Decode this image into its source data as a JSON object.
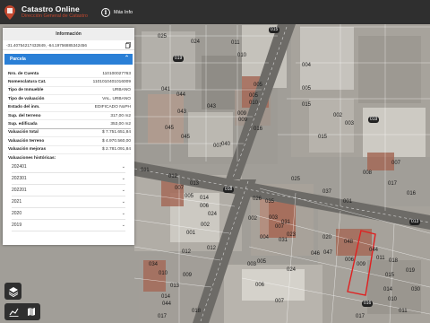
{
  "header": {
    "title": "Catastro Online",
    "subtitle": "Dirección General de Catastro",
    "more_info_label": "Más Info"
  },
  "panel": {
    "title": "Información",
    "coordinates": "-31.40754217432849, -64.19756885342456",
    "section_title": "Parcela",
    "rows": [
      {
        "key": "Nro. de Cuenta",
        "value": "110100027763"
      },
      {
        "key": "Nomenclatura Cat.",
        "value": "110101040101600​9"
      },
      {
        "key": "Tipo de Inmueble",
        "value": "URBANO"
      },
      {
        "key": "Tipo de valuación",
        "value": "VAL. URBANO"
      },
      {
        "key": "Estado del inm.",
        "value": "EDIFICADO NoPH"
      },
      {
        "key": "Sup. del terreno",
        "value": "317,00 m2"
      },
      {
        "key": "Sup. edificada",
        "value": "353,00 m2"
      },
      {
        "key": "Valuación total",
        "value": "$ 7.751.651,84"
      },
      {
        "key": "Valuación terreno",
        "value": "$ 4.970.560,00"
      },
      {
        "key": "Valuación mejoras",
        "value": "$ 2.781.091,84"
      }
    ],
    "history_title": "Valuaciones históricas:",
    "history_years": [
      "202401",
      "202301",
      "202201",
      "2021",
      "2020",
      "2019"
    ]
  },
  "map": {
    "block_labels": [
      "019",
      "015",
      "019",
      "013",
      "016",
      "018"
    ],
    "parcel_labels": [
      "025",
      "024",
      "011",
      "010",
      "005",
      "041",
      "044",
      "043",
      "005",
      "010",
      "043",
      "045",
      "045",
      "040",
      "015",
      "009",
      "009",
      "016",
      "015",
      "002",
      "003",
      "005",
      "004",
      "025",
      "037",
      "001",
      "008",
      "007",
      "016",
      "017",
      "011",
      "012",
      "013",
      "014",
      "007",
      "005",
      "006",
      "024",
      "026",
      "035",
      "002",
      "003",
      "004",
      "007",
      "031",
      "031",
      "023",
      "002",
      "001",
      "012",
      "034",
      "010",
      "009",
      "012",
      "013",
      "014",
      "044",
      "003",
      "005",
      "006",
      "007",
      "024",
      "020",
      "048",
      "047",
      "046",
      "009",
      "006",
      "044",
      "011",
      "018",
      "019",
      "015",
      "014",
      "030",
      "017",
      "011",
      "010",
      "007",
      "017",
      "018"
    ],
    "colors": {
      "highlight": "#e02020",
      "accent": "#2a7fd6",
      "brand": "#c2472f"
    }
  },
  "controls": {
    "icons": [
      "layers-icon",
      "measure-icon",
      "map-book-icon"
    ]
  }
}
